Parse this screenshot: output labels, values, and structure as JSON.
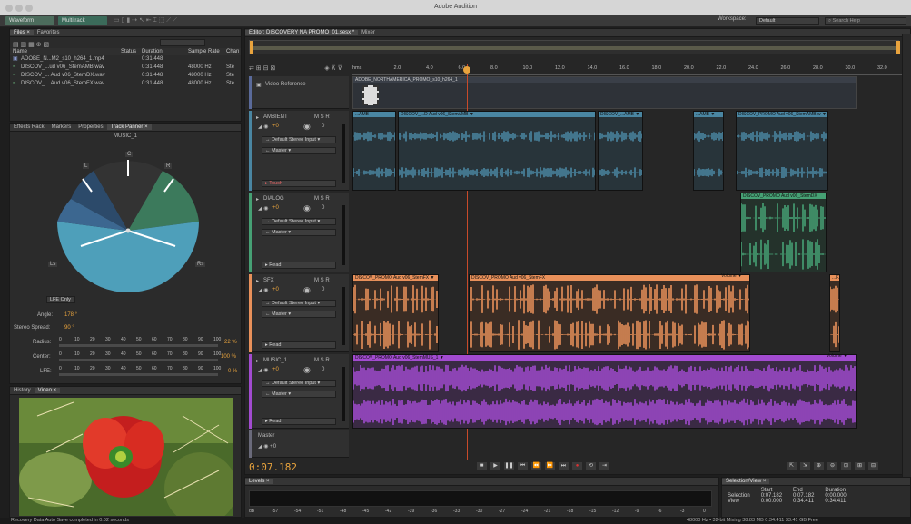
{
  "app": {
    "title": "Adobe Audition"
  },
  "toolbar": {
    "waveform": "Waveform",
    "multitrack": "Multitrack",
    "workspace_label": "Workspace:",
    "workspace_value": "Default",
    "search_placeholder": "Search Help"
  },
  "files_panel": {
    "tabs": [
      "Files ×",
      "Favorites"
    ],
    "columns": {
      "name": "Name",
      "status": "Status",
      "duration": "Duration",
      "rate": "Sample Rate",
      "chan": "Chan"
    },
    "rows": [
      {
        "name": "ADOBE_N...M2_s10_h264_1.mp4",
        "duration": "0:31.448",
        "rate": "",
        "chan": ""
      },
      {
        "name": "DISCOV_...ud v06_StemAMB.wav",
        "duration": "0:31.448",
        "rate": "48000 Hz",
        "chan": "Ste"
      },
      {
        "name": "DISCOV_... Aud v06_StemDX.wav",
        "duration": "0:31.448",
        "rate": "48000 Hz",
        "chan": "Ste"
      },
      {
        "name": "DISCOV_... Aud v06_StemFX.wav",
        "duration": "0:31.448",
        "rate": "48000 Hz",
        "chan": "Ste"
      }
    ]
  },
  "panner_panel": {
    "tabs": [
      "Effects Rack",
      "Markers",
      "Properties",
      "Track Panner ×"
    ],
    "track": "MUSIC_1",
    "speakers": {
      "l": "L",
      "c": "C",
      "r": "R",
      "ls": "Ls",
      "rs": "Rs"
    },
    "lfe_only": "LFE Only",
    "angle_label": "Angle:",
    "angle_value": "178 °",
    "spread_label": "Stereo Spread:",
    "spread_value": "90 °",
    "radius_label": "Radius:",
    "radius_value": "22 %",
    "center_label": "Center:",
    "center_value": "100 %",
    "lfe_label": "LFE:",
    "lfe_value": "0 %",
    "scale": [
      "0",
      "10",
      "20",
      "30",
      "40",
      "50",
      "60",
      "70",
      "80",
      "90",
      "100"
    ]
  },
  "video_panel": {
    "tabs": [
      "History",
      "Video ×"
    ]
  },
  "editor": {
    "tabs": [
      "Editor: DISCOVERY NA PROMO_01.sesx *",
      "Mixer"
    ],
    "ruler": [
      "hms",
      "2.0",
      "4.0",
      "6.0",
      "8.0",
      "10.0",
      "12.0",
      "14.0",
      "16.0",
      "18.0",
      "20.0",
      "22.0",
      "24.0",
      "26.0",
      "28.0",
      "30.0",
      "32.0",
      "34.0"
    ],
    "video_track": {
      "name": "Video Reference",
      "clip": "ADOBE_NORTHAMERICA_PROMO_s10_h264_1"
    },
    "tracks": [
      {
        "name": "AMBIENT",
        "vol": "+0",
        "pan": "0",
        "input": "Default Stereo Input",
        "output": "Master",
        "mode": "Touch",
        "color": "#4a86a2",
        "clips": [
          {
            "label": "...AMB"
          },
          {
            "label": "DISCOV_...D Aud v06_StemAMB ▼"
          },
          {
            "label": "DISCOV_...AMB ▼"
          },
          {
            "label": "...AMB ▼"
          },
          {
            "label": "DISCOV_PROMO Aud v06_StemAMB.w ▼"
          }
        ]
      },
      {
        "name": "DIALOG",
        "vol": "+0",
        "pan": "0",
        "input": "Default Stereo Input",
        "output": "Master",
        "mode": "Read",
        "color": "#46a074",
        "clips": [
          {
            "label": "DISCOV_PROMO Aud v06_StemDX"
          }
        ]
      },
      {
        "name": "SFX",
        "vol": "+0",
        "pan": "0",
        "input": "Default Stereo Input",
        "output": "Master",
        "mode": "Read",
        "color": "#e8905a",
        "clips": [
          {
            "label": "DISCOV_PROMO Aud v06_StemFX ▼"
          },
          {
            "label": "DISCOV_PROMO Aud v06_StemFX"
          },
          {
            "label": "...FX"
          }
        ],
        "env_label": "Volume ▼"
      },
      {
        "name": "MUSIC_1",
        "vol": "+0",
        "pan": "0",
        "input": "Default Stereo Input",
        "output": "Master",
        "mode": "Read",
        "color": "#a24bd0",
        "clips": [
          {
            "label": "DISCOV_PROMO Aud v06_StemMUS_1 ▼"
          }
        ],
        "env_label": "Volume ▼"
      }
    ],
    "master": "Master",
    "timecode": "0:07.182"
  },
  "levels": {
    "title": "Levels ×",
    "scale": [
      "dB",
      "-57",
      "-54",
      "-51",
      "-48",
      "-45",
      "-42",
      "-39",
      "-36",
      "-33",
      "-30",
      "-27",
      "-24",
      "-21",
      "-18",
      "-15",
      "-12",
      "-9",
      "-6",
      "-3",
      "0"
    ]
  },
  "selection": {
    "title": "Selection/View ×",
    "headers": [
      "Start",
      "End",
      "Duration"
    ],
    "rows": [
      {
        "label": "Selection",
        "start": "0:07.182",
        "end": "0:07.182",
        "dur": "0:00.000"
      },
      {
        "label": "View",
        "start": "0:00.000",
        "end": "0:34.411",
        "dur": "0:34.411"
      }
    ]
  },
  "status": {
    "left": "Recovery Data Auto Save completed in 0.02 seconds",
    "right": "48000 Hz • 32-bit Mixing   38.83 MB   0:34.411   33.41 GB Free"
  },
  "colors": {
    "ambient": "#4a86a2",
    "dialog": "#46a074",
    "sfx": "#e8905a",
    "music": "#a24bd0",
    "playhead": "#e8a33d"
  }
}
